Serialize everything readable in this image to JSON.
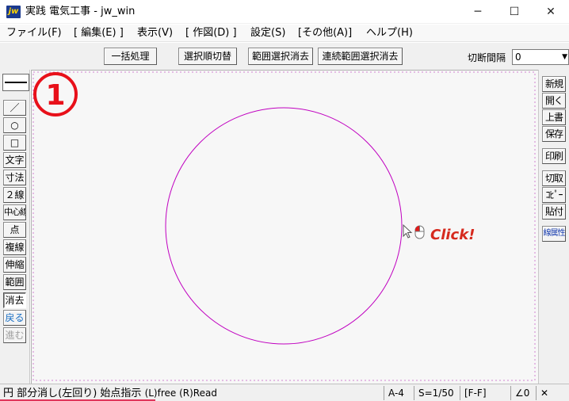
{
  "window": {
    "icon_text": "jw",
    "title": "実践 電気工事 - jw_win",
    "min_glyph": "─",
    "max_glyph": "☐",
    "close_glyph": "✕"
  },
  "menu": [
    "ファイル(F)",
    "[ 編集(E) ]",
    "表示(V)",
    "[ 作図(D) ]",
    "設定(S)",
    "[その他(A)]",
    "ヘルプ(H)"
  ],
  "toolbar": {
    "buttons": [
      "一括処理",
      "選択順切替",
      "範囲選択消去",
      "連続範囲選択消去"
    ],
    "interval_label": "切断間隔",
    "interval_value": "0"
  },
  "left_tools": [
    "／",
    "○",
    "□",
    "文字",
    "寸法",
    "２線",
    "中心線",
    "点",
    "複線",
    "伸縮",
    "範囲",
    "消去",
    "戻る",
    "進む"
  ],
  "right_tools": [
    "新規",
    "開く",
    "上書",
    "保存",
    "印刷",
    "切取",
    "ｺﾋﾟｰ",
    "貼付",
    "線属性"
  ],
  "canvas": {
    "step_number": "1",
    "callout": "Click!"
  },
  "status": {
    "message": "円 部分消し(左回り) 始点指示",
    "hint": "(L)free (R)Read",
    "paper": "A-4",
    "scale": "S=1/50",
    "layer": "[F-F]",
    "angle": "∠0",
    "close": "✕"
  },
  "colors": {
    "circle": "#c000c0",
    "step_badge": "#e8101a",
    "callout": "#d62a1e",
    "status_underline": "#e0365b"
  }
}
